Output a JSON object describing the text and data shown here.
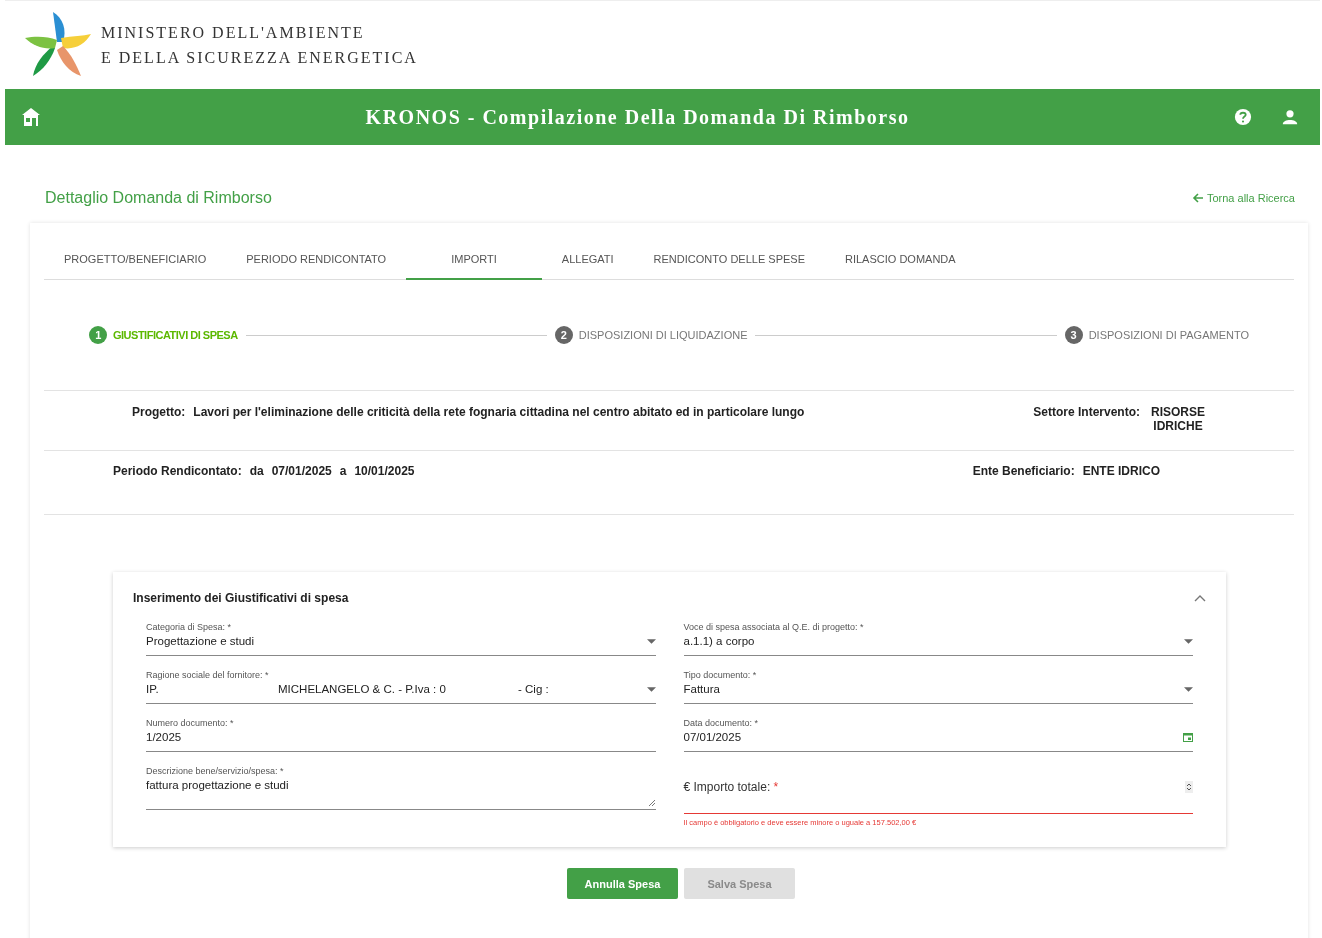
{
  "header": {
    "ministry_lines": [
      "MINISTERO DELL'AMBIENTE",
      "E DELLA SICUREZZA ENERGETICA"
    ]
  },
  "app_bar": {
    "title": "KRONOS - Compilazione Della Domanda Di Rimborso"
  },
  "page": {
    "title": "Dettaglio Domanda di Rimborso",
    "back_link": "Torna alla Ricerca"
  },
  "tabs": [
    {
      "label": "PROGETTO/BENEFICIARIO",
      "selected": false
    },
    {
      "label": "PERIODO RENDICONTATO",
      "selected": false
    },
    {
      "label": "IMPORTI",
      "selected": true
    },
    {
      "label": "ALLEGATI",
      "selected": false
    },
    {
      "label": "RENDICONTO DELLE SPESE",
      "selected": false
    },
    {
      "label": "RILASCIO DOMANDA",
      "selected": false
    }
  ],
  "steps": [
    {
      "number": "1",
      "label": "GIUSTIFICATIVI DI SPESA",
      "selected": true
    },
    {
      "number": "2",
      "label": "DISPOSIZIONI DI LIQUIDAZIONE",
      "selected": false
    },
    {
      "number": "3",
      "label": "DISPOSIZIONI DI PAGAMENTO",
      "selected": false
    }
  ],
  "summary": {
    "project_label": "Progetto:",
    "project_value": "Lavori per l'eliminazione delle criticità della rete fognaria cittadina nel centro abitato ed in particolare lungo",
    "sector_label": "Settore Intervento:",
    "sector_value": "RISORSE IDRICHE",
    "period_label": "Periodo Rendicontato:",
    "period_from_label": "da",
    "period_from": "07/01/2025",
    "period_to_label": "a",
    "period_to": "10/01/2025",
    "entity_label": "Ente Beneficiario:",
    "entity_value": "ENTE IDRICO"
  },
  "form": {
    "title": "Inserimento dei Giustificativi di spesa",
    "expanded": true,
    "fields": [
      {
        "kind": "select",
        "label": "Categoria di Spesa:",
        "mark": "*",
        "value": "Progettazione e studi",
        "error": false
      },
      {
        "kind": "select",
        "label": "Voce di spesa associata al Q.E. di progetto:",
        "mark": "*",
        "value": "a.1.1) a corpo",
        "error": false
      },
      {
        "kind": "select",
        "label": "Ragione sociale del fornitore:",
        "mark": "*",
        "segments": [
          "IP.",
          "MICHELANGELO & C. - P.Iva : 0",
          "- Cig :"
        ],
        "error": false
      },
      {
        "kind": "select",
        "label": "Tipo documento:",
        "mark": "*",
        "value": "Fattura",
        "error": false
      },
      {
        "kind": "text",
        "label": "Numero documento:",
        "mark": "*",
        "value": "1/2025",
        "error": false
      },
      {
        "kind": "date",
        "label": "Data documento:",
        "mark": "*",
        "value": "07/01/2025",
        "error": false
      },
      {
        "kind": "textarea",
        "label": "Descrizione bene/servizio/spesa:",
        "mark": "*",
        "value": "fattura progettazione e studi",
        "error": false
      },
      {
        "kind": "number",
        "label": "€ Importo totale:",
        "mark": "*",
        "error": true,
        "error_message": "Il campo è obbligatorio e deve essere minore o uguale a 157.502,00 €"
      }
    ]
  },
  "buttons": [
    {
      "label": "Annulla Spesa",
      "disabled": false
    },
    {
      "label": "Salva Spesa",
      "disabled": true
    }
  ]
}
